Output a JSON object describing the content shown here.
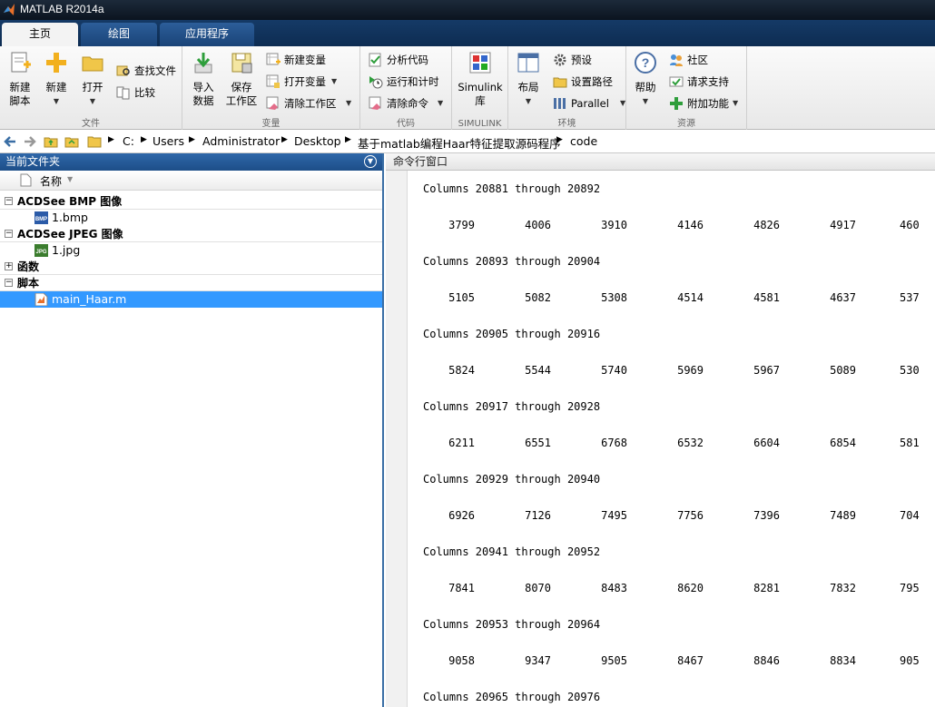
{
  "window": {
    "title": "MATLAB R2014a"
  },
  "tabs": [
    {
      "label": "主页"
    },
    {
      "label": "绘图"
    },
    {
      "label": "应用程序"
    }
  ],
  "ribbon": {
    "file": {
      "label": "文件",
      "new_script": [
        "新建",
        "脚本"
      ],
      "new": "新建",
      "open": "打开",
      "find_files": "查找文件",
      "compare": "比较"
    },
    "variable": {
      "label": "变量",
      "import": [
        "导入",
        "数据"
      ],
      "save": [
        "保存",
        "工作区"
      ],
      "new_var": "新建变量",
      "open_var": "打开变量",
      "clear_ws": "清除工作区"
    },
    "code": {
      "label": "代码",
      "analyze": "分析代码",
      "run_time": "运行和计时",
      "clear_cmd": "清除命令"
    },
    "simulink": {
      "label": "SIMULINK",
      "lib": [
        "Simulink",
        "库"
      ]
    },
    "env": {
      "label": "环境",
      "layout": "布局",
      "prefs": "预设",
      "set_path": "设置路径",
      "parallel": "Parallel"
    },
    "resources": {
      "label": "资源",
      "help": "帮助",
      "community": "社区",
      "support": "请求支持",
      "addons": "附加功能"
    }
  },
  "address": {
    "crumbs": [
      "C:",
      "Users",
      "Administrator",
      "Desktop",
      "基于matlab编程Haar特征提取源码程序",
      "code"
    ]
  },
  "current_folder": {
    "title": "当前文件夹",
    "column_name": "名称",
    "groups": [
      {
        "label": "ACDSee BMP 图像",
        "toggle": "−",
        "files": [
          {
            "name": "1.bmp",
            "icon": "bmp-icon",
            "selected": false
          }
        ]
      },
      {
        "label": "ACDSee JPEG 图像",
        "toggle": "−",
        "files": [
          {
            "name": "1.jpg",
            "icon": "jpg-icon",
            "selected": false
          }
        ]
      },
      {
        "label": "函数",
        "toggle": "+",
        "files": []
      },
      {
        "label": "脚本",
        "toggle": "−",
        "files": [
          {
            "name": "main_Haar.m",
            "icon": "m-file-icon",
            "selected": true
          }
        ]
      }
    ]
  },
  "command_window": {
    "title": "命令行窗口",
    "blocks": [
      {
        "header": "Columns 20881 through 20892",
        "values": [
          "3799",
          "4006",
          "3910",
          "4146",
          "4826",
          "4917",
          "460"
        ]
      },
      {
        "header": "Columns 20893 through 20904",
        "values": [
          "5105",
          "5082",
          "5308",
          "4514",
          "4581",
          "4637",
          "537"
        ]
      },
      {
        "header": "Columns 20905 through 20916",
        "values": [
          "5824",
          "5544",
          "5740",
          "5969",
          "5967",
          "5089",
          "530"
        ]
      },
      {
        "header": "Columns 20917 through 20928",
        "values": [
          "6211",
          "6551",
          "6768",
          "6532",
          "6604",
          "6854",
          "581"
        ]
      },
      {
        "header": "Columns 20929 through 20940",
        "values": [
          "6926",
          "7126",
          "7495",
          "7756",
          "7396",
          "7489",
          "704"
        ]
      },
      {
        "header": "Columns 20941 through 20952",
        "values": [
          "7841",
          "8070",
          "8483",
          "8620",
          "8281",
          "7832",
          "795"
        ]
      },
      {
        "header": "Columns 20953 through 20964",
        "values": [
          "9058",
          "9347",
          "9505",
          "8467",
          "8846",
          "8834",
          "905"
        ]
      },
      {
        "header": "Columns 20965 through 20976",
        "values": []
      }
    ]
  }
}
